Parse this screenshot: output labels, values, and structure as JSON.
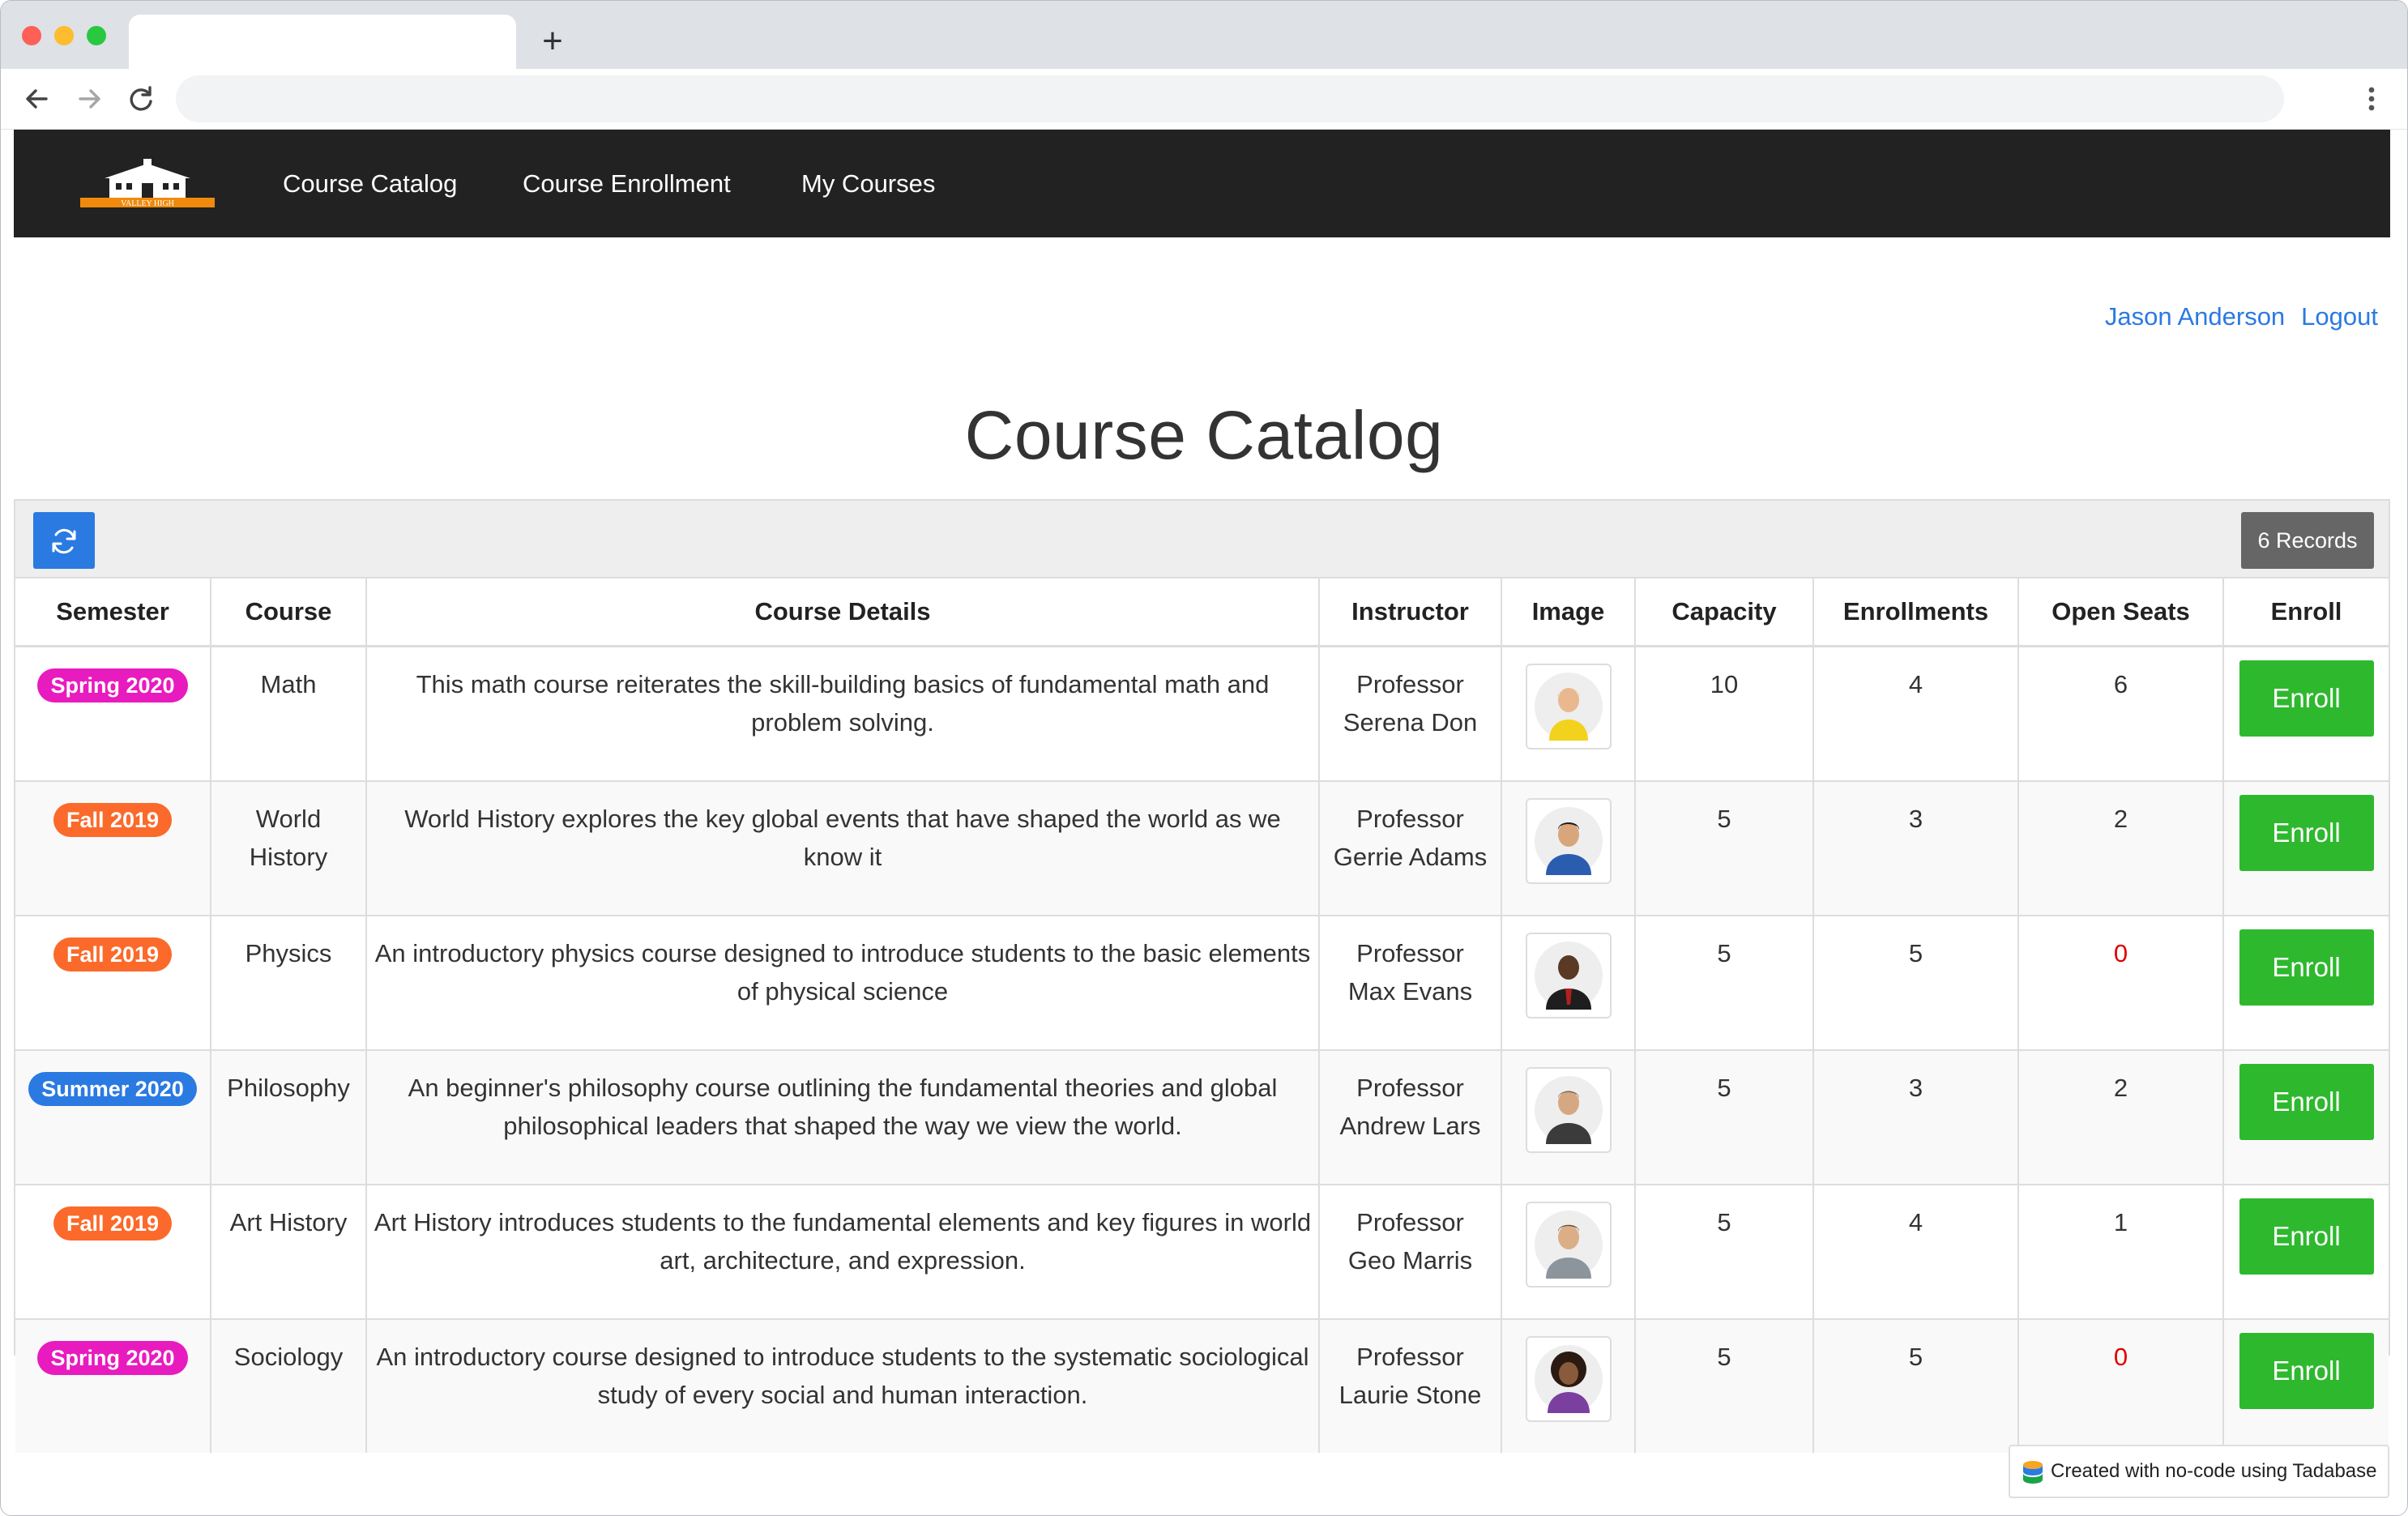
{
  "browser": {
    "tab_title": "",
    "new_tab": "+",
    "address": ""
  },
  "nav": {
    "logo_text": "VALLEY HIGH",
    "links": [
      "Course Catalog",
      "Course Enrollment",
      "My Courses"
    ]
  },
  "user": {
    "name": "Jason Anderson",
    "logout": "Logout"
  },
  "page": {
    "title": "Course Catalog"
  },
  "table": {
    "records": "6 Records",
    "headers": [
      "Semester",
      "Course",
      "Course Details",
      "Instructor",
      "Image",
      "Capacity",
      "Enrollments",
      "Open Seats",
      "Enroll"
    ],
    "rows": [
      {
        "semester": "Spring 2020",
        "semester_color": "#e81bbf",
        "course": "Math",
        "details": "This math course reiterates the skill-building basics of fundamental math and problem solving.",
        "instructor_1": "Professor",
        "instructor_2": "Serena Don",
        "image": "avatar-woman-yellow",
        "capacity": "10",
        "enrollments": "4",
        "open_seats": "6",
        "enroll": "Enroll"
      },
      {
        "semester": "Fall 2019",
        "semester_color": "#fb6a2a",
        "course": "World History",
        "details": "World History explores the key global events that have shaped the world as we know it",
        "instructor_1": "Professor",
        "instructor_2": "Gerrie Adams",
        "image": "avatar-man-blue",
        "capacity": "5",
        "enrollments": "3",
        "open_seats": "2",
        "enroll": "Enroll"
      },
      {
        "semester": "Fall 2019",
        "semester_color": "#fb6a2a",
        "course": "Physics",
        "details": "An introductory physics course designed to introduce students to the basic elements of physical science",
        "instructor_1": "Professor",
        "instructor_2": "Max Evans",
        "image": "avatar-man-suit",
        "capacity": "5",
        "enrollments": "5",
        "open_seats": "0",
        "enroll": "Enroll"
      },
      {
        "semester": "Summer 2020",
        "semester_color": "#2a7ae2",
        "course": "Philosophy",
        "details": "An beginner's philosophy course outlining the fundamental theories and global philosophical leaders that shaped the way we view the world.",
        "instructor_1": "Professor",
        "instructor_2": "Andrew Lars",
        "image": "avatar-man-grey",
        "capacity": "5",
        "enrollments": "3",
        "open_seats": "2",
        "enroll": "Enroll"
      },
      {
        "semester": "Fall 2019",
        "semester_color": "#fb6a2a",
        "course": "Art History",
        "details": "Art History introduces students to the fundamental elements and key figures in world art, architecture, and expression.",
        "instructor_1": "Professor",
        "instructor_2": "Geo Marris",
        "image": "avatar-man-jacket",
        "capacity": "5",
        "enrollments": "4",
        "open_seats": "1",
        "enroll": "Enroll"
      },
      {
        "semester": "Spring 2020",
        "semester_color": "#e81bbf",
        "course": "Sociology",
        "details": "An introductory course designed to introduce students to the systematic sociological study of every social and human interaction.",
        "instructor_1": "Professor",
        "instructor_2": "Laurie Stone",
        "image": "avatar-woman-purple",
        "capacity": "5",
        "enrollments": "5",
        "open_seats": "0",
        "enroll": "Enroll"
      }
    ]
  },
  "footer": {
    "credit": "Created with no-code using Tadabase"
  },
  "colors": {
    "accent": "#2a7ae2",
    "enroll_button": "#2eb82e",
    "navbar": "#222222",
    "zero_seats": "#e00000"
  }
}
